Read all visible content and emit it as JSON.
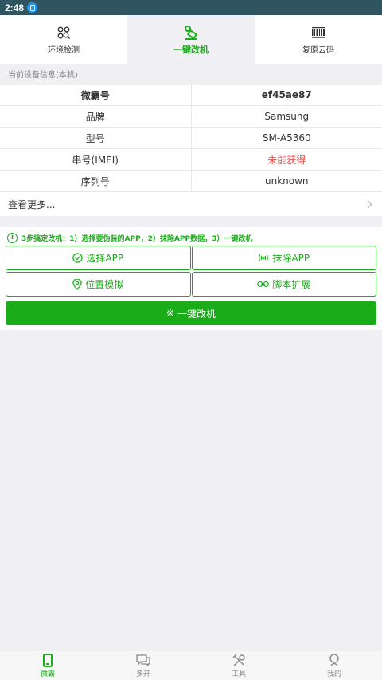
{
  "status": {
    "time": "2:48"
  },
  "top_tabs": [
    {
      "label": "环境检测",
      "icon": "search-icon",
      "active": false
    },
    {
      "label": "一键改机",
      "icon": "broom-icon",
      "active": true
    },
    {
      "label": "复原云码",
      "icon": "barcode-icon",
      "active": false
    }
  ],
  "device_info": {
    "section_title": "当前设备信息(本机)",
    "header": {
      "label": "微霸号",
      "value": "ef45ae87"
    },
    "rows": [
      {
        "label": "品牌",
        "value": "Samsung"
      },
      {
        "label": "型号",
        "value": "SM-A5360"
      },
      {
        "label": "串号(IMEI)",
        "value": "未能获得"
      },
      {
        "label": "序列号",
        "value": "unknown"
      }
    ],
    "see_more": "查看更多..."
  },
  "actions": {
    "hint": "3步搞定改机：1）选择要伪装的APP，2）抹除APP数据，3）一键改机",
    "select_app": "选择APP",
    "erase_app": "抹除APP",
    "location_sim": "位置模拟",
    "script_ext": "脚本扩展",
    "one_click": "一键改机"
  },
  "bottom_nav": [
    {
      "label": "微霸",
      "icon": "phone-icon",
      "active": true
    },
    {
      "label": "多开",
      "icon": "chat-icon",
      "active": false
    },
    {
      "label": "工具",
      "icon": "tools-icon",
      "active": false
    },
    {
      "label": "我的",
      "icon": "user-icon",
      "active": false
    }
  ],
  "colors": {
    "accent": "#1aad19",
    "warning": "#f05050",
    "status_bar": "#2f5560"
  }
}
